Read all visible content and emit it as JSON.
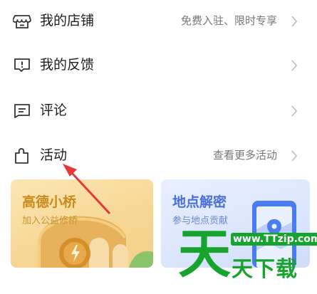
{
  "menu": {
    "store": {
      "label": "我的店铺",
      "hint": "免费入驻、限时专享",
      "icon": "store-icon"
    },
    "feedback": {
      "label": "我的反馈",
      "icon": "feedback-icon"
    },
    "comments": {
      "label": "评论",
      "icon": "comment-icon"
    },
    "activity": {
      "label": "活动",
      "hint": "查看更多活动",
      "icon": "puzzle-icon"
    }
  },
  "cards": {
    "gaode": {
      "title": "高德小桥",
      "subtitle": "加入公益修桥"
    },
    "map": {
      "title": "地点解密",
      "subtitle": "参与地点贡献"
    }
  },
  "watermark": {
    "big": "天",
    "url": "www.TTzip.com",
    "text": "天下载"
  },
  "colors": {
    "annotation_arrow": "#e5383b",
    "watermark": "#17a42e",
    "gaode_accent": "#c98a1c",
    "map_accent": "#4a6fd9"
  }
}
